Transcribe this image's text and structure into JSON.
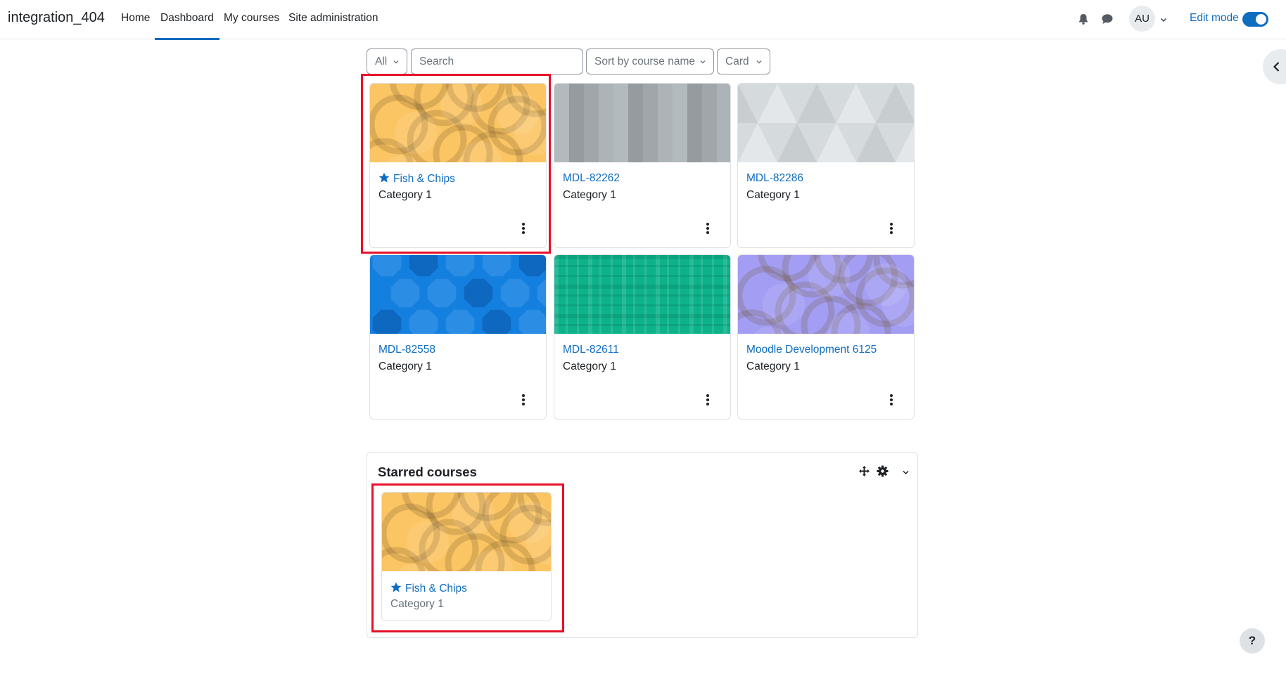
{
  "site": {
    "name": "integration_404"
  },
  "nav": {
    "items": [
      {
        "label": "Home",
        "active": false
      },
      {
        "label": "Dashboard",
        "active": true
      },
      {
        "label": "My courses",
        "active": false
      },
      {
        "label": "Site administration",
        "active": false
      }
    ],
    "user_initials": "AU",
    "edit_mode_label": "Edit mode",
    "edit_mode_on": true
  },
  "filters": {
    "grouping": "All",
    "search_placeholder": "Search",
    "sort": "Sort by course name",
    "view": "Card"
  },
  "courses": [
    {
      "name": "Fish & Chips",
      "category": "Category 1",
      "starred": true,
      "pattern": "circles",
      "color": "#fbc563"
    },
    {
      "name": "MDL-82262",
      "category": "Category 1",
      "starred": false,
      "pattern": "squares",
      "color": "#b7bec2"
    },
    {
      "name": "MDL-82286",
      "category": "Category 1",
      "starred": false,
      "pattern": "triangles",
      "color": "#d5dadd"
    },
    {
      "name": "MDL-82558",
      "category": "Category 1",
      "starred": false,
      "pattern": "octagons",
      "color": "#1380e0"
    },
    {
      "name": "MDL-82611",
      "category": "Category 1",
      "starred": false,
      "pattern": "plaid",
      "color": "#0db28a"
    },
    {
      "name": "Moodle Development 6125",
      "category": "Category 1",
      "starred": false,
      "pattern": "circles",
      "color": "#a39ef4"
    }
  ],
  "starred_block": {
    "title": "Starred courses",
    "courses": [
      {
        "name": "Fish & Chips",
        "category": "Category 1",
        "pattern": "circles",
        "color": "#fbc563"
      }
    ]
  },
  "help_label": "?",
  "colors": {
    "accent": "#0f6cbf",
    "highlight": "#e8102a"
  }
}
